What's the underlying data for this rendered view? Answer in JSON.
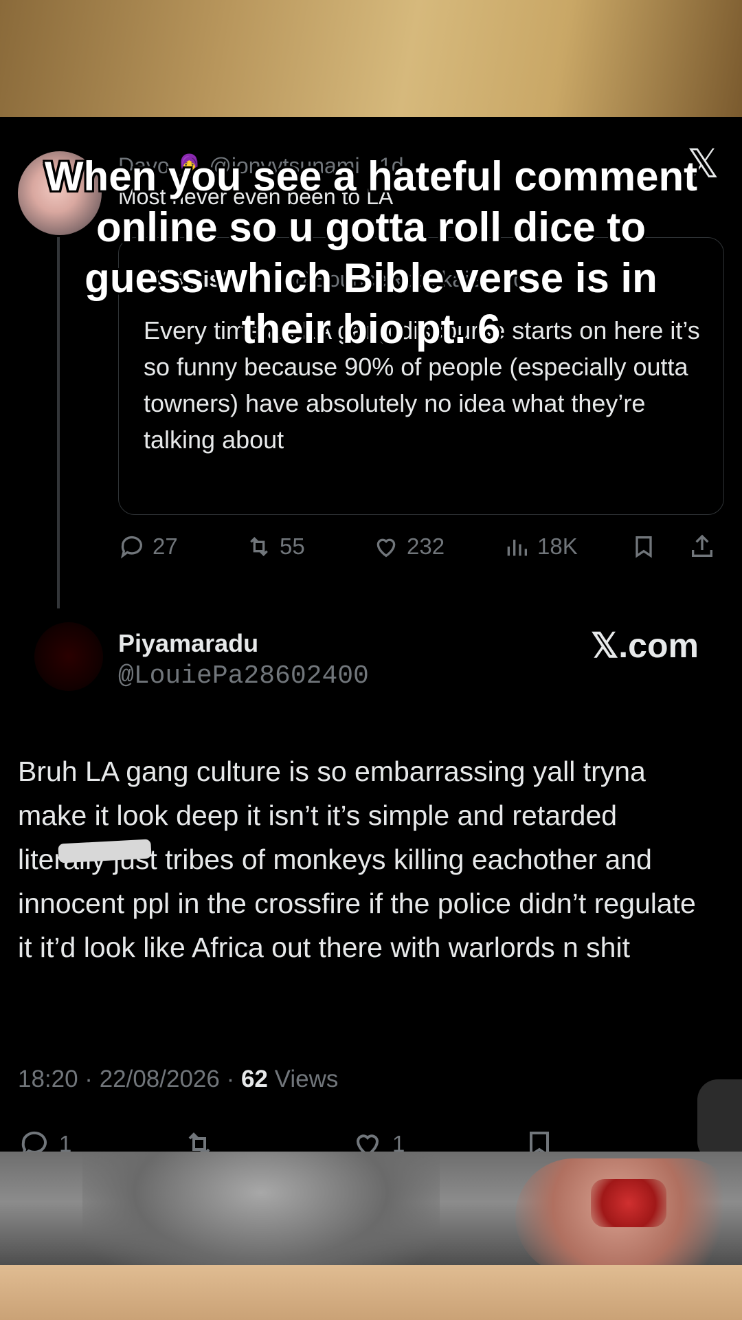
{
  "parent_tweet": {
    "handle_line": "Davo 🧕 @jonvvtsunami · 1d",
    "text": "Most never even been to LA"
  },
  "quote_tweet": {
    "name": "Ti Sinister",
    "handle_time": "@BounceRocSkaie · 1d",
    "text": "Every time an LA gang discourse starts on here it’s so funny because 90% of people (especially outta towners) have absolutely no idea what they’re talking about"
  },
  "parent_actions": {
    "replies": "27",
    "reposts": "55",
    "likes": "232",
    "views": "18K"
  },
  "reply": {
    "name": "Piyamaradu",
    "handle": "@LouiePa28602400",
    "brand": "𝕏.com",
    "text": "Bruh LA gang culture is so embarrassing yall tryna make it look deep it isn’t it’s simple and retarded literally just tribes of monkeys killing eachother and innocent ppl in the crossfire if the police didn’t regulate it it’d look like Africa out there with warlords n shit",
    "timestamp": "18:20 · 22/08/2026 · ",
    "views_count": "62",
    "views_label": " Views",
    "replies": "1",
    "likes": "1"
  },
  "close_icon_label": "𝕏",
  "caption": "When you see a hateful comment online so u gotta roll dice to guess which Bible verse is in their bio pt. 6",
  "colors": {
    "background": "#000000",
    "muted": "#71767b",
    "text": "#e7e9ea"
  }
}
